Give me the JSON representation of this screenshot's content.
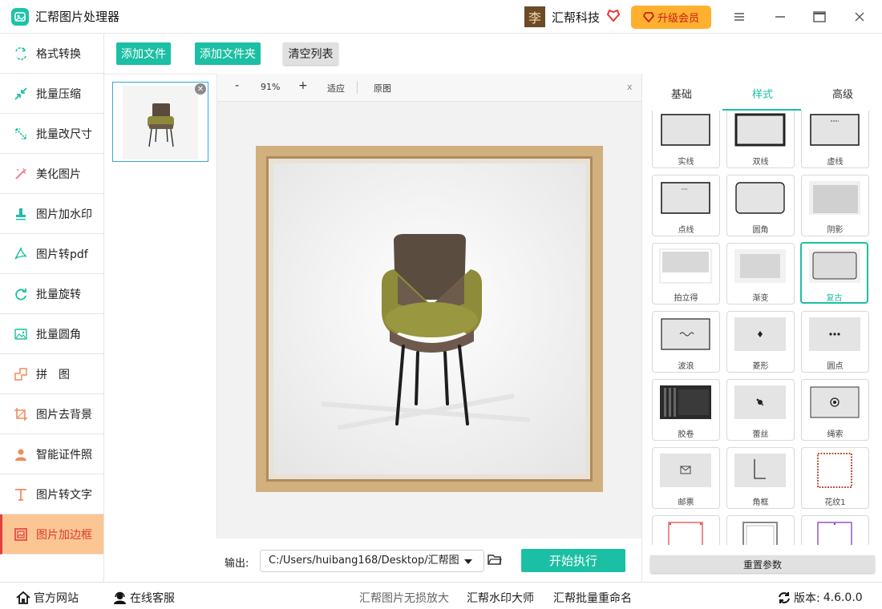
{
  "app": {
    "title": "汇帮图片处理器",
    "brand_avatar": "李",
    "brand_name": "汇帮科技",
    "vip_label": "升级会员",
    "accent": "#1bbfa3",
    "active_color": "#fcc594"
  },
  "sidebar": {
    "items": [
      {
        "label": "格式转换",
        "icon": "format-convert-icon"
      },
      {
        "label": "批量压缩",
        "icon": "compress-icon"
      },
      {
        "label": "批量改尺寸",
        "icon": "resize-icon"
      },
      {
        "label": "美化图片",
        "icon": "beautify-icon"
      },
      {
        "label": "图片加水印",
        "icon": "watermark-icon"
      },
      {
        "label": "图片转pdf",
        "icon": "pdf-icon"
      },
      {
        "label": "批量旋转",
        "icon": "rotate-icon"
      },
      {
        "label": "批量圆角",
        "icon": "round-corner-icon"
      },
      {
        "label": "拼　图",
        "icon": "puzzle-icon"
      },
      {
        "label": "图片去背景",
        "icon": "crop-icon"
      },
      {
        "label": "智能证件照",
        "icon": "id-photo-icon"
      },
      {
        "label": "图片转文字",
        "icon": "text-icon"
      },
      {
        "label": "图片加边框",
        "icon": "frame-icon",
        "active": true
      }
    ]
  },
  "toolbar": {
    "add_file": "添加文件",
    "add_folder": "添加文件夹",
    "clear_list": "清空列表"
  },
  "preview_toolbar": {
    "zoom_out": "-",
    "zoom_level": "91%",
    "zoom_in": "+",
    "fit": "适应",
    "original": "原图",
    "close": "x"
  },
  "output": {
    "label": "输出:",
    "path": "C:/Users/huibang168/Desktop/汇帮图",
    "start": "开始执行"
  },
  "panel": {
    "tabs": [
      "基础",
      "样式",
      "高级"
    ],
    "active_tab": 1,
    "styles": [
      "实线",
      "双线",
      "虚线",
      "点线",
      "圆角",
      "阴影",
      "拍立得",
      "渐变",
      "复古",
      "波浪",
      "菱形",
      "圆点",
      "胶卷",
      "蕾丝",
      "绳索",
      "邮票",
      "角框",
      "花纹1"
    ],
    "selected_style": "复古",
    "reset": "重置参数"
  },
  "statusbar": {
    "website": "官方网站",
    "service": "在线客服",
    "link1": "汇帮图片无损放大",
    "link2": "汇帮水印大师",
    "link3": "汇帮批量重命名",
    "version_label": "版本:",
    "version": "4.6.0.0"
  }
}
